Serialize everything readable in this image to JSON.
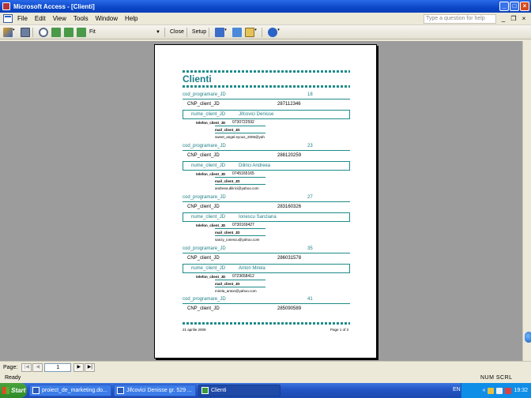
{
  "window": {
    "title": "Microsoft Access - [Clienti]"
  },
  "menu": {
    "items": [
      "File",
      "Edit",
      "View",
      "Tools",
      "Window",
      "Help"
    ],
    "help_placeholder": "Type a question for help"
  },
  "toolbar": {
    "zoom_value": "Fit",
    "close_label": "Close",
    "setup_label": "Setup"
  },
  "report": {
    "title": "Clienti",
    "records": [
      {
        "cod_label": "cod_programare_JD",
        "cod_value": "18",
        "cnp_label": "CNP_client_JD",
        "cnp_value": "287112346",
        "name_label": "nume_client_JD",
        "name_value": "Jifcovici Denisse",
        "tel_label": "telefon_client_JD",
        "tel_value": "0730722592",
        "mail_label": "mail_client_JD",
        "mail_value": "sweet_angel.eyous_2005@yah"
      },
      {
        "cod_label": "cod_programare_JD",
        "cod_value": "23",
        "cnp_label": "CNP_client_JD",
        "cnp_value": "288120259",
        "name_label": "nume_client_JD",
        "name_value": "Dilirici Andreea",
        "tel_label": "telefon_client_JD",
        "tel_value": "0745165165",
        "mail_label": "mail_client_JD",
        "mail_value": "andreea.dilirici@yahoo.com"
      },
      {
        "cod_label": "cod_programare_JD",
        "cod_value": "27",
        "cnp_label": "CNP_client_JD",
        "cnp_value": "283160326",
        "name_label": "nume_client_JD",
        "name_value": "Ionescu Sanziana",
        "tel_label": "telefon_client_JD",
        "tel_value": "0730169427",
        "mail_label": "mail_client_JD",
        "mail_value": "sanzy_ionescu@yahoo.com"
      },
      {
        "cod_label": "cod_programare_JD",
        "cod_value": "35",
        "cnp_label": "CNP_client_JD",
        "cnp_value": "286031578",
        "name_label": "nume_client_JD",
        "name_value": "Anton Mirela",
        "tel_label": "telefon_client_JD",
        "tel_value": "0723658412",
        "mail_label": "mail_client_JD",
        "mail_value": "mirela_anton@yahoo.com"
      },
      {
        "cod_label": "cod_programare_JD",
        "cod_value": "41",
        "cnp_label": "CNP_client_JD",
        "cnp_value": "285090589"
      }
    ],
    "footer_date": "21 aprilie 2009",
    "footer_page": "Page 1 of 3"
  },
  "status": {
    "page_label": "Page:",
    "page_value": "1",
    "ready_text": "Ready",
    "indicators": "NUM  SCRL"
  },
  "taskbar": {
    "start_label": "Start",
    "tasks": [
      "proiect_de_marketing.do...",
      "Jifcovici Denisse gr. 529 ...",
      "Clienti"
    ],
    "language": "EN",
    "clock": "19:32"
  }
}
